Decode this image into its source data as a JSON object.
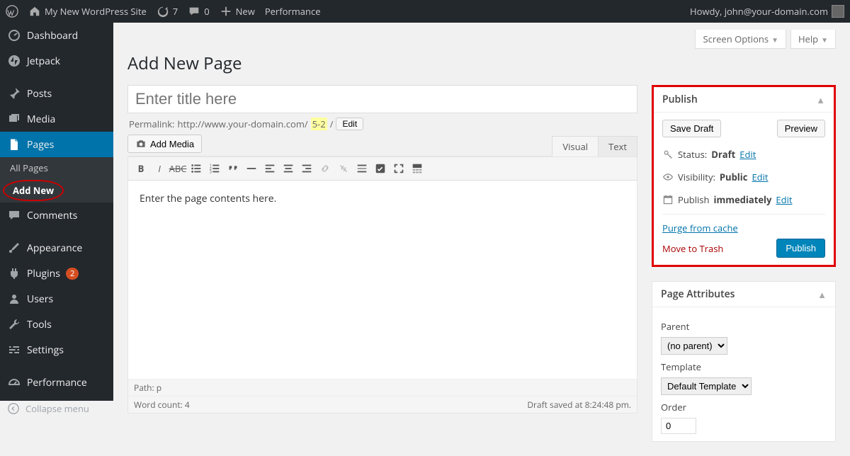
{
  "adminbar": {
    "site_name": "My New WordPress Site",
    "refresh_count": "7",
    "comments_count": "0",
    "new_label": "New",
    "performance_label": "Performance",
    "howdy": "Howdy, john@your-domain.com"
  },
  "screen_meta": {
    "screen_options": "Screen Options",
    "help": "Help"
  },
  "page_title": "Add New Page",
  "sidebar": {
    "dashboard": "Dashboard",
    "jetpack": "Jetpack",
    "posts": "Posts",
    "media": "Media",
    "pages": "Pages",
    "all_pages": "All Pages",
    "add_new": "Add New",
    "comments": "Comments",
    "appearance": "Appearance",
    "plugins": "Plugins",
    "plugins_count": "2",
    "users": "Users",
    "tools": "Tools",
    "settings": "Settings",
    "performance": "Performance",
    "collapse": "Collapse menu"
  },
  "editor": {
    "title_placeholder": "Enter title here",
    "permalink_label": "Permalink:",
    "permalink_base": "http://www.your-domain.com/",
    "permalink_slug": "5-2",
    "permalink_suffix": "/",
    "edit_label": "Edit",
    "add_media": "Add Media",
    "tab_visual": "Visual",
    "tab_text": "Text",
    "body_text": "Enter the page contents here.",
    "path_label": "Path: p",
    "word_count_label": "Word count: 4",
    "draft_saved": "Draft saved at 8:24:48 pm."
  },
  "publish": {
    "title": "Publish",
    "save_draft": "Save Draft",
    "preview": "Preview",
    "status_label": "Status:",
    "status_value": "Draft",
    "visibility_label": "Visibility:",
    "visibility_value": "Public",
    "publish_label": "Publish",
    "immediately": "immediately",
    "edit": "Edit",
    "purge": "Purge from cache",
    "trash": "Move to Trash",
    "publish_btn": "Publish"
  },
  "attributes": {
    "title": "Page Attributes",
    "parent_label": "Parent",
    "parent_value": "(no parent)",
    "template_label": "Template",
    "template_value": "Default Template",
    "order_label": "Order",
    "order_value": "0"
  }
}
